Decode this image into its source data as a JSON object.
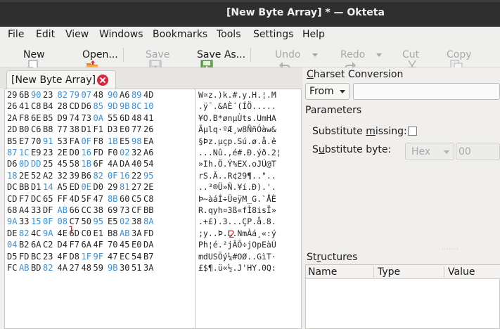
{
  "window": {
    "title": "[New Byte Array] * — Okteta"
  },
  "menubar": {
    "items": [
      "File",
      "Edit",
      "View",
      "Windows",
      "Bookmarks",
      "Tools",
      "Settings",
      "Help"
    ]
  },
  "toolbar": {
    "new_label": "New",
    "open_label": "Open...",
    "save_label": "Save",
    "save_as_label": "Save As...",
    "undo_label": "Undo",
    "redo_label": "Redo",
    "cut_label": "Cut",
    "copy_label": "Copy"
  },
  "tabs": {
    "document_tab": "[New Byte Array]"
  },
  "hex_rows": [
    [
      [
        "29",
        "k"
      ],
      [
        "6B",
        "k"
      ],
      [
        "90",
        "b"
      ],
      [
        "23",
        "k"
      ],
      [
        "82",
        "b"
      ],
      [
        "79",
        "b"
      ],
      [
        "07",
        "b"
      ],
      [
        "48",
        "k"
      ],
      [
        "90",
        "b"
      ],
      [
        "A6",
        "k"
      ],
      [
        "89",
        "b"
      ],
      [
        "4D",
        "k"
      ]
    ],
    [
      [
        "26",
        "k"
      ],
      [
        "41",
        "k"
      ],
      [
        "C8",
        "k"
      ],
      [
        "B4",
        "k"
      ],
      [
        "28",
        "k"
      ],
      [
        "CD",
        "k"
      ],
      [
        "D6",
        "k"
      ],
      [
        "85",
        "b"
      ],
      [
        "9D",
        "b"
      ],
      [
        "9B",
        "b"
      ],
      [
        "8C",
        "b"
      ],
      [
        "10",
        "b"
      ]
    ],
    [
      [
        "2A",
        "k"
      ],
      [
        "F8",
        "k"
      ],
      [
        "6E",
        "k"
      ],
      [
        "B5",
        "k"
      ],
      [
        "D9",
        "k"
      ],
      [
        "74",
        "k"
      ],
      [
        "73",
        "k"
      ],
      [
        "0A",
        "b"
      ],
      [
        "55",
        "k"
      ],
      [
        "6D",
        "k"
      ],
      [
        "48",
        "k"
      ],
      [
        "41",
        "k"
      ]
    ],
    [
      [
        "2D",
        "k"
      ],
      [
        "B0",
        "k"
      ],
      [
        "C6",
        "k"
      ],
      [
        "B8",
        "k"
      ],
      [
        "77",
        "k"
      ],
      [
        "38",
        "k"
      ],
      [
        "D1",
        "k"
      ],
      [
        "F1",
        "k"
      ],
      [
        "D3",
        "k"
      ],
      [
        "E0",
        "k"
      ],
      [
        "77",
        "k"
      ],
      [
        "26",
        "k"
      ]
    ],
    [
      [
        "B5",
        "k"
      ],
      [
        "E7",
        "k"
      ],
      [
        "70",
        "k"
      ],
      [
        "91",
        "b"
      ],
      [
        "53",
        "k"
      ],
      [
        "FA",
        "k"
      ],
      [
        "0F",
        "b"
      ],
      [
        "F8",
        "k"
      ],
      [
        "1B",
        "b"
      ],
      [
        "E5",
        "k"
      ],
      [
        "98",
        "b"
      ],
      [
        "EA",
        "k"
      ]
    ],
    [
      [
        "87",
        "b"
      ],
      [
        "1C",
        "b"
      ],
      [
        "E9",
        "k"
      ],
      [
        "23",
        "k"
      ],
      [
        "2E",
        "k"
      ],
      [
        "D0",
        "k"
      ],
      [
        "16",
        "b"
      ],
      [
        "FD",
        "k"
      ],
      [
        "F0",
        "k"
      ],
      [
        "02",
        "b"
      ],
      [
        "32",
        "k"
      ],
      [
        "A6",
        "k"
      ]
    ],
    [
      [
        "D6",
        "k"
      ],
      [
        "0D",
        "b"
      ],
      [
        "DD",
        "b"
      ],
      [
        "25",
        "k"
      ],
      [
        "45",
        "k"
      ],
      [
        "58",
        "k"
      ],
      [
        "1B",
        "b"
      ],
      [
        "6F",
        "k"
      ],
      [
        "4A",
        "k"
      ],
      [
        "DA",
        "k"
      ],
      [
        "40",
        "k"
      ],
      [
        "54",
        "k"
      ]
    ],
    [
      [
        "18",
        "b"
      ],
      [
        "2E",
        "k"
      ],
      [
        "52",
        "k"
      ],
      [
        "A2",
        "k"
      ],
      [
        "32",
        "k"
      ],
      [
        "39",
        "k"
      ],
      [
        "B6",
        "k"
      ],
      [
        "82",
        "b"
      ],
      [
        "0F",
        "b"
      ],
      [
        "16",
        "b"
      ],
      [
        "22",
        "k"
      ],
      [
        "95",
        "b"
      ]
    ],
    [
      [
        "DC",
        "k"
      ],
      [
        "BB",
        "k"
      ],
      [
        "D1",
        "k"
      ],
      [
        "14",
        "b"
      ],
      [
        "A5",
        "k"
      ],
      [
        "ED",
        "k"
      ],
      [
        "0E",
        "b"
      ],
      [
        "D0",
        "k"
      ],
      [
        "29",
        "k"
      ],
      [
        "81",
        "b"
      ],
      [
        "27",
        "k"
      ],
      [
        "2E",
        "k"
      ]
    ],
    [
      [
        "CD",
        "k"
      ],
      [
        "F7",
        "k"
      ],
      [
        "DC",
        "k"
      ],
      [
        "65",
        "k"
      ],
      [
        "FF",
        "k"
      ],
      [
        "4D",
        "k"
      ],
      [
        "5F",
        "k"
      ],
      [
        "47",
        "k"
      ],
      [
        "8B",
        "b"
      ],
      [
        "60",
        "k"
      ],
      [
        "C5",
        "k"
      ],
      [
        "C8",
        "k"
      ]
    ],
    [
      [
        "68",
        "k"
      ],
      [
        "A4",
        "k"
      ],
      [
        "33",
        "k"
      ],
      [
        "DF",
        "k"
      ],
      [
        "AB",
        "b"
      ],
      [
        "66",
        "k"
      ],
      [
        "CC",
        "k"
      ],
      [
        "38",
        "k"
      ],
      [
        "69",
        "k"
      ],
      [
        "73",
        "k"
      ],
      [
        "CF",
        "k"
      ],
      [
        "BB",
        "k"
      ]
    ],
    [
      [
        "9A",
        "b"
      ],
      [
        "33",
        "k"
      ],
      [
        "15",
        "b"
      ],
      [
        "0F",
        "b"
      ],
      [
        "08",
        "b"
      ],
      [
        "C7",
        "k"
      ],
      [
        "50",
        "k"
      ],
      [
        "95",
        "b"
      ],
      [
        "E5",
        "k"
      ],
      [
        "02",
        "b"
      ],
      [
        "38",
        "k"
      ],
      [
        "8A",
        "b"
      ]
    ],
    [
      [
        "DE",
        "k"
      ],
      [
        "82",
        "b"
      ],
      [
        "4C",
        "k"
      ],
      [
        "9A",
        "b"
      ],
      [
        "4E",
        "k"
      ],
      [
        "6D",
        "k"
      ],
      [
        "C0",
        "k"
      ],
      [
        "E1",
        "k"
      ],
      [
        "B8",
        "k"
      ],
      [
        "AB",
        "b"
      ],
      [
        "3A",
        "k"
      ],
      [
        "FD",
        "k"
      ]
    ],
    [
      [
        "04",
        "b"
      ],
      [
        "B2",
        "k"
      ],
      [
        "6A",
        "k"
      ],
      [
        "C2",
        "k"
      ],
      [
        "D4",
        "k"
      ],
      [
        "F7",
        "k"
      ],
      [
        "6A",
        "k"
      ],
      [
        "4F",
        "k"
      ],
      [
        "70",
        "k"
      ],
      [
        "45",
        "k"
      ],
      [
        "E0",
        "k"
      ],
      [
        "DA",
        "k"
      ]
    ],
    [
      [
        "D5",
        "k"
      ],
      [
        "FD",
        "k"
      ],
      [
        "BC",
        "k"
      ],
      [
        "23",
        "k"
      ],
      [
        "4F",
        "k"
      ],
      [
        "D8",
        "k"
      ],
      [
        "1F",
        "b"
      ],
      [
        "9F",
        "b"
      ],
      [
        "47",
        "k"
      ],
      [
        "EC",
        "k"
      ],
      [
        "54",
        "k"
      ],
      [
        "B7",
        "k"
      ]
    ],
    [
      [
        "FC",
        "k"
      ],
      [
        "AB",
        "b"
      ],
      [
        "BD",
        "k"
      ],
      [
        "82",
        "b"
      ],
      [
        "4A",
        "k"
      ],
      [
        "27",
        "k"
      ],
      [
        "48",
        "k"
      ],
      [
        "59",
        "k"
      ],
      [
        "9B",
        "b"
      ],
      [
        "30",
        "k"
      ],
      [
        "51",
        "k"
      ],
      [
        "3A",
        "k"
      ]
    ]
  ],
  "char_rows": [
    "W¤z.)k.#.y.H.¦.M",
    ".ÿ¯.&AÈ´(ÍÖ.....",
    "¥O.B*ønµÙts.UmHA",
    "Ãµlq·ºÆ¸w8ÑñÓàw&",
    "§Þz.µçp.Sú.ø.å.ê",
    "...Nû.,é#.Ð.ýð.2¦",
    "»Ih.Ö.Ý%EX.oJÚ@T",
    "rS.Ã..R¢29¶..\"..",
    "..³®Ü»Ñ.¥í.Ð).'.",
    "Þ~àáÍ÷ÜeÿM_G.`ÅÈ",
    "R.qyh¤3ß«fÌ8isÏ»",
    ".+£).3...ÇP.å.8.",
    ";y..Þ.L.NmÀá¸«:ý",
    "Ph¦é.²jÂÔ÷jOpEàÚ",
    "mdUSÕý¼#OØ..GìT·",
    "£$¶.ü«½.J'HY.0Q:"
  ],
  "annotations": {
    "label_1": "1",
    "label_2": "2"
  },
  "charset_panel": {
    "title": "Charset Conversion",
    "direction": "From",
    "charset_value": "",
    "parameters_title": "Parameters",
    "substitute_missing_label": "Substitute missing:",
    "substitute_missing_checked": false,
    "substitute_byte_label": "Substitute byte:",
    "substitute_byte_format": "Hex",
    "substitute_byte_value": "00"
  },
  "structures_panel": {
    "title": "Structures",
    "columns": [
      "Name",
      "Type",
      "Value"
    ]
  },
  "colors": {
    "title_bar": "#2f2f2f",
    "hex_blue": "#3b8fd6",
    "close_red": "#d7263a",
    "annotation_red": "#e02020"
  }
}
